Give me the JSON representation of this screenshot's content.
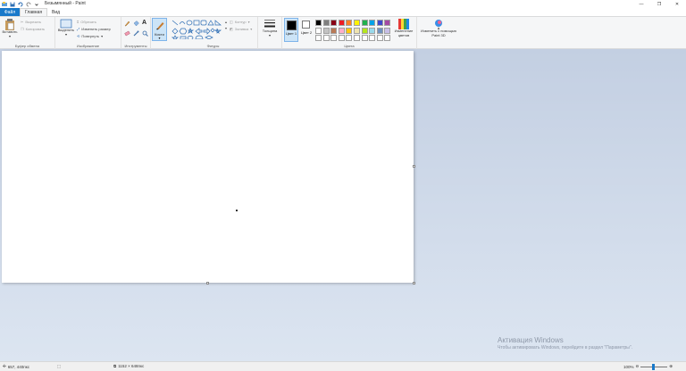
{
  "window": {
    "title": "Безымянный - Paint",
    "controls": [
      "minimize",
      "maximize",
      "close"
    ]
  },
  "tabs": [
    {
      "label": "Файл",
      "active": false
    },
    {
      "label": "Главная",
      "active": true
    },
    {
      "label": "Вид",
      "active": false
    }
  ],
  "ribbon": {
    "clipboard": {
      "label": "Буфер обмена",
      "paste": "Вставить",
      "cut": "Вырезать",
      "copy": "Копировать"
    },
    "image": {
      "label": "Изображение",
      "select": "Выделить",
      "crop": "Обрезать",
      "resize": "Изменить размер",
      "rotate": "Повернуть"
    },
    "tools": {
      "label": "Инструменты",
      "brushes": "Кисти"
    },
    "shapes": {
      "label": "Фигуры",
      "outline": "Контур",
      "fill": "Заливка"
    },
    "thickness": "Толщина",
    "colors": {
      "label": "Цвета",
      "color1": "Цвет 1",
      "color2": "Цвет 2",
      "edit_colors": "Изменение цветов",
      "paint3d": "Изменить с помощью Paint 3D",
      "palette_row1": [
        "#000000",
        "#7f7f7f",
        "#880015",
        "#ed1c24",
        "#ff7f27",
        "#fff200",
        "#22b14c",
        "#00a2e8",
        "#3f48cc",
        "#a349a4"
      ],
      "palette_row2": [
        "#ffffff",
        "#c3c3c3",
        "#b97a57",
        "#ffaec9",
        "#ffc90e",
        "#efe4b0",
        "#b5e61d",
        "#99d9ea",
        "#7092be",
        "#c8bfe7"
      ],
      "color1_value": "#000000",
      "color2_value": "#ffffff"
    }
  },
  "activation": {
    "title": "Активация Windows",
    "subtitle": "Чтобы активировать Windows, перейдите в раздел \"Параметры\"."
  },
  "status": {
    "cursor_pos": "657, 440пкс",
    "canvas_size": "1152 × 648пкс",
    "zoom": "100%"
  }
}
